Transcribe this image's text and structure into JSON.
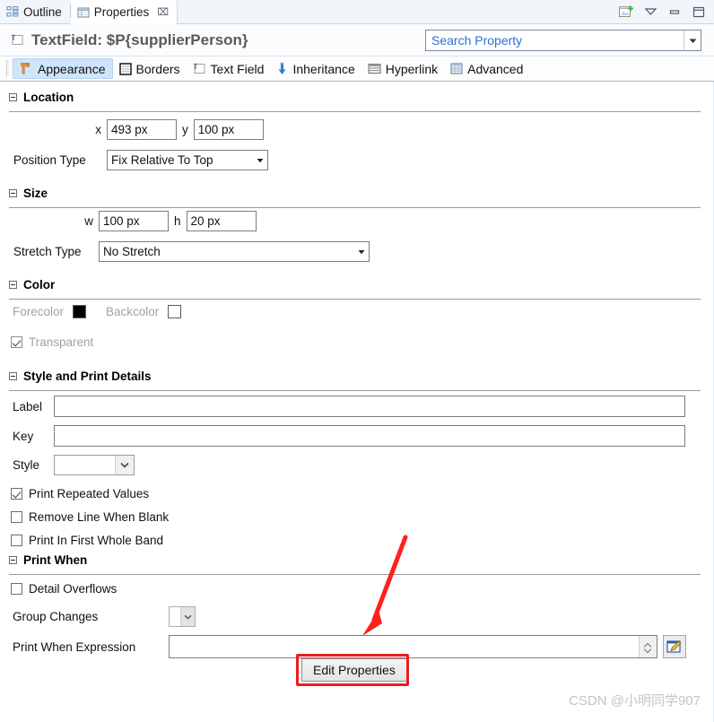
{
  "view_tabs": [
    {
      "label": "Outline",
      "icon": "outline-icon",
      "active": false
    },
    {
      "label": "Properties",
      "icon": "properties-icon",
      "active": true,
      "close": "⌧"
    }
  ],
  "view_tools": [
    {
      "name": "new-properties-view-icon",
      "tip": "New Properties View"
    },
    {
      "name": "view-menu-icon",
      "tip": "View Menu"
    },
    {
      "name": "minimize-icon",
      "tip": "Minimize"
    },
    {
      "name": "maximize-icon",
      "tip": "Maximize"
    }
  ],
  "header": {
    "icon": "textfield-icon",
    "title": "TextField: $P{supplierPerson}"
  },
  "search": {
    "placeholder": "Search Property",
    "value": "",
    "arrow": "▾"
  },
  "property_tabs": [
    {
      "label": "Appearance",
      "icon": "appearance-icon",
      "selected": true
    },
    {
      "label": "Borders",
      "icon": "borders-icon",
      "selected": false
    },
    {
      "label": "Text Field",
      "icon": "textfield-icon",
      "selected": false
    },
    {
      "label": "Inheritance",
      "icon": "inheritance-icon",
      "selected": false
    },
    {
      "label": "Hyperlink",
      "icon": "hyperlink-icon",
      "selected": false
    },
    {
      "label": "Advanced",
      "icon": "advanced-icon",
      "selected": false
    }
  ],
  "sections": {
    "location": {
      "title": "Location",
      "x_label": "x",
      "x_value": "493 px",
      "y_label": "y",
      "y_value": "100 px",
      "position_type_label": "Position Type",
      "position_type_value": "Fix Relative To Top"
    },
    "size": {
      "title": "Size",
      "w_label": "w",
      "w_value": "100 px",
      "h_label": "h",
      "h_value": "20 px",
      "stretch_type_label": "Stretch Type",
      "stretch_type_value": "No Stretch"
    },
    "color": {
      "title": "Color",
      "forecolor_label": "Forecolor",
      "forecolor_value": "#000000",
      "backcolor_label": "Backcolor",
      "backcolor_value": "#ffffff",
      "transparent_label": "Transparent",
      "transparent_checked": true
    },
    "style_print": {
      "title": "Style and Print Details",
      "label_label": "Label",
      "label_value": "",
      "key_label": "Key",
      "key_value": "",
      "style_label": "Style",
      "style_value": "",
      "checkboxes": [
        {
          "label": "Print Repeated Values",
          "checked": true
        },
        {
          "label": "Remove Line When Blank",
          "checked": false
        },
        {
          "label": "Print In First Whole Band",
          "checked": false
        }
      ]
    },
    "print_when": {
      "title": "Print When",
      "detail_overflows_label": "Detail Overflows",
      "detail_overflows_checked": false,
      "group_changes_label": "Group Changes",
      "group_changes_value": "",
      "print_when_expression_label": "Print When Expression",
      "print_when_expression_value": ""
    }
  },
  "edit_properties_button": {
    "label": "Edit Properties",
    "highlight_color": "#ee1c1c"
  },
  "annotation": {
    "arrow_color": "#ff2020"
  },
  "watermark": "CSDN @小明同学907"
}
